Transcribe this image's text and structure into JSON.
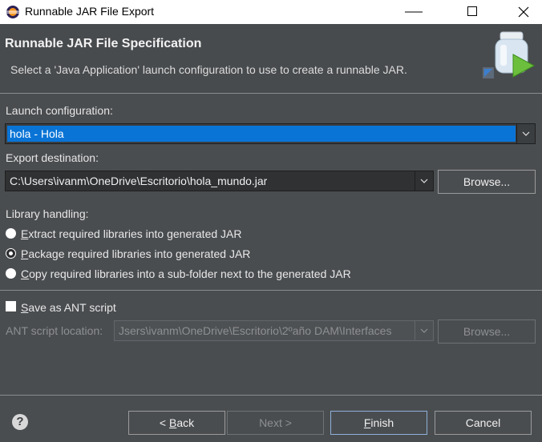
{
  "window": {
    "title": "Runnable JAR File Export",
    "controls": [
      "minimize-icon",
      "maximize-icon",
      "close-icon"
    ]
  },
  "header": {
    "title": "Runnable JAR File Specification",
    "description": "Select a 'Java Application' launch configuration to use to create a runnable JAR.",
    "banner_icon": "jar-export-wizard-icon"
  },
  "launch": {
    "label": "Launch configuration:",
    "value": "hola - Hola"
  },
  "export": {
    "label": "Export destination:",
    "value": "C:\\Users\\ivanm\\OneDrive\\Escritorio\\hola_mundo.jar",
    "browse_pre": "Browse",
    "browse_post": "..."
  },
  "library": {
    "label": "Library handling:",
    "options": [
      {
        "mnemonic": "E",
        "rest": "xtract required libraries into generated JAR",
        "selected": false
      },
      {
        "mnemonic": "P",
        "rest": "ackage required libraries into generated JAR",
        "selected": true
      },
      {
        "mnemonic": "C",
        "rest": "opy required libraries into a sub-folder next to the generated JAR",
        "selected": false
      }
    ]
  },
  "ant": {
    "checkbox_mnemonic": "S",
    "checkbox_rest": "ave as ANT script",
    "checked": false,
    "location_label": "ANT script location:",
    "location_value": "Jsers\\ivanm\\OneDrive\\Escritorio\\2ºaño DAM\\Interfaces",
    "browse": "Browse..."
  },
  "footer": {
    "back_pre": "< ",
    "back_mnemonic": "B",
    "back_rest": "ack",
    "next": "Next >",
    "finish_mnemonic": "F",
    "finish_rest": "inish",
    "cancel": "Cancel",
    "help_glyph": "?"
  },
  "colors": {
    "background": "#4a4d50",
    "selection": "#0a74d6",
    "titlebar": "#ffffff"
  }
}
